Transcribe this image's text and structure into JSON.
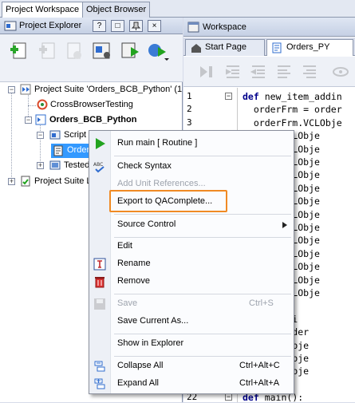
{
  "top_tabs": [
    {
      "label": "Project Workspace",
      "active": true
    },
    {
      "label": "Object Browser",
      "active": false
    }
  ],
  "project_explorer": {
    "title": "Project Explorer",
    "header_buttons": [
      "?",
      "□",
      "×"
    ],
    "tree": [
      {
        "label": "Project Suite 'Orders_BCB_Python' (1",
        "icon": "project-suite-icon",
        "bold": false
      },
      {
        "label": "CrossBrowserTesting",
        "icon": "cross-browser-icon",
        "bold": false
      },
      {
        "label": "Orders_BCB_Python",
        "icon": "project-icon",
        "bold": true
      },
      {
        "label": "Script",
        "icon": "script-folder-icon",
        "bold": false
      },
      {
        "label": "Orders_PY",
        "icon": "script-unit-icon",
        "bold": false
      },
      {
        "label": "Tested",
        "icon": "tested-apps-icon",
        "bold": false
      },
      {
        "label": "Project Suite L",
        "icon": "suite-logs-icon",
        "bold": false
      }
    ]
  },
  "workspace": {
    "title": "Workspace",
    "tabs": [
      {
        "label": "Start Page",
        "active": false
      },
      {
        "label": "Orders_PY",
        "active": true
      }
    ],
    "code_lines": [
      {
        "num": "1",
        "text": "def new_item_addin"
      },
      {
        "num": "2",
        "text": "  orderFrm = order"
      },
      {
        "num": "3",
        "text": "  orderFrm.VCLObje"
      },
      {
        "num": "",
        "text": "    rm.VCLObje"
      },
      {
        "num": "",
        "text": "    rm.VCLObje"
      },
      {
        "num": "",
        "text": "    rm.VCLObje"
      },
      {
        "num": "",
        "text": "    rm.VCLObje"
      },
      {
        "num": "",
        "text": "    rm.VCLObje"
      },
      {
        "num": "",
        "text": "    rm.VCLObje"
      },
      {
        "num": "",
        "text": "    rm.VCLObje"
      },
      {
        "num": "",
        "text": "    rm.VCLObje"
      },
      {
        "num": "",
        "text": "    rm.VCLObje"
      },
      {
        "num": "",
        "text": "    rm.VCLObje"
      },
      {
        "num": "",
        "text": "    rm.VCLObje"
      },
      {
        "num": "",
        "text": "    rm.VCLObje"
      },
      {
        "num": "",
        "text": "    rm.VCLObje"
      },
      {
        "num": "",
        "text": ""
      },
      {
        "num": "",
        "text": "ges_existi"
      },
      {
        "num": "",
        "text": "  rm = order"
      },
      {
        "num": "",
        "text": "  rm.VCLObje"
      },
      {
        "num": "",
        "text": "  rm.VCLObje"
      },
      {
        "num": "",
        "text": "  rm.VCLObje"
      },
      {
        "num": "",
        "text": ""
      },
      {
        "num": "22",
        "text": "def main():"
      }
    ]
  },
  "context_menu": {
    "items": [
      {
        "label": "Run main  [ Routine ]",
        "shortcut": "",
        "icon": "run-icon",
        "disabled": false,
        "submenu": false
      },
      {
        "label": "Check Syntax",
        "shortcut": "",
        "icon": "check-syntax-icon",
        "disabled": false,
        "submenu": false
      },
      {
        "label": "Add Unit References...",
        "shortcut": "",
        "icon": "",
        "disabled": true,
        "submenu": false
      },
      {
        "label": "Export to QAComplete...",
        "shortcut": "",
        "icon": "",
        "disabled": false,
        "submenu": false
      },
      {
        "label": "Source Control",
        "shortcut": "",
        "icon": "",
        "disabled": false,
        "submenu": true
      },
      {
        "label": "Edit",
        "shortcut": "",
        "icon": "",
        "disabled": false,
        "submenu": false
      },
      {
        "label": "Rename",
        "shortcut": "",
        "icon": "rename-icon",
        "disabled": false,
        "submenu": false
      },
      {
        "label": "Remove",
        "shortcut": "",
        "icon": "trash-icon",
        "disabled": false,
        "submenu": false
      },
      {
        "label": "Save",
        "shortcut": "Ctrl+S",
        "icon": "save-icon",
        "disabled": true,
        "submenu": false
      },
      {
        "label": "Save Current As...",
        "shortcut": "",
        "icon": "",
        "disabled": false,
        "submenu": false
      },
      {
        "label": "Show in Explorer",
        "shortcut": "",
        "icon": "",
        "disabled": false,
        "submenu": false
      },
      {
        "label": "Collapse All",
        "shortcut": "Ctrl+Alt+C",
        "icon": "collapse-all-icon",
        "disabled": false,
        "submenu": false
      },
      {
        "label": "Expand All",
        "shortcut": "Ctrl+Alt+A",
        "icon": "expand-all-icon",
        "disabled": false,
        "submenu": false
      }
    ]
  },
  "colors": {
    "highlight": "#f08a24",
    "selection": "#3399ff",
    "keyword": "#00008b"
  }
}
